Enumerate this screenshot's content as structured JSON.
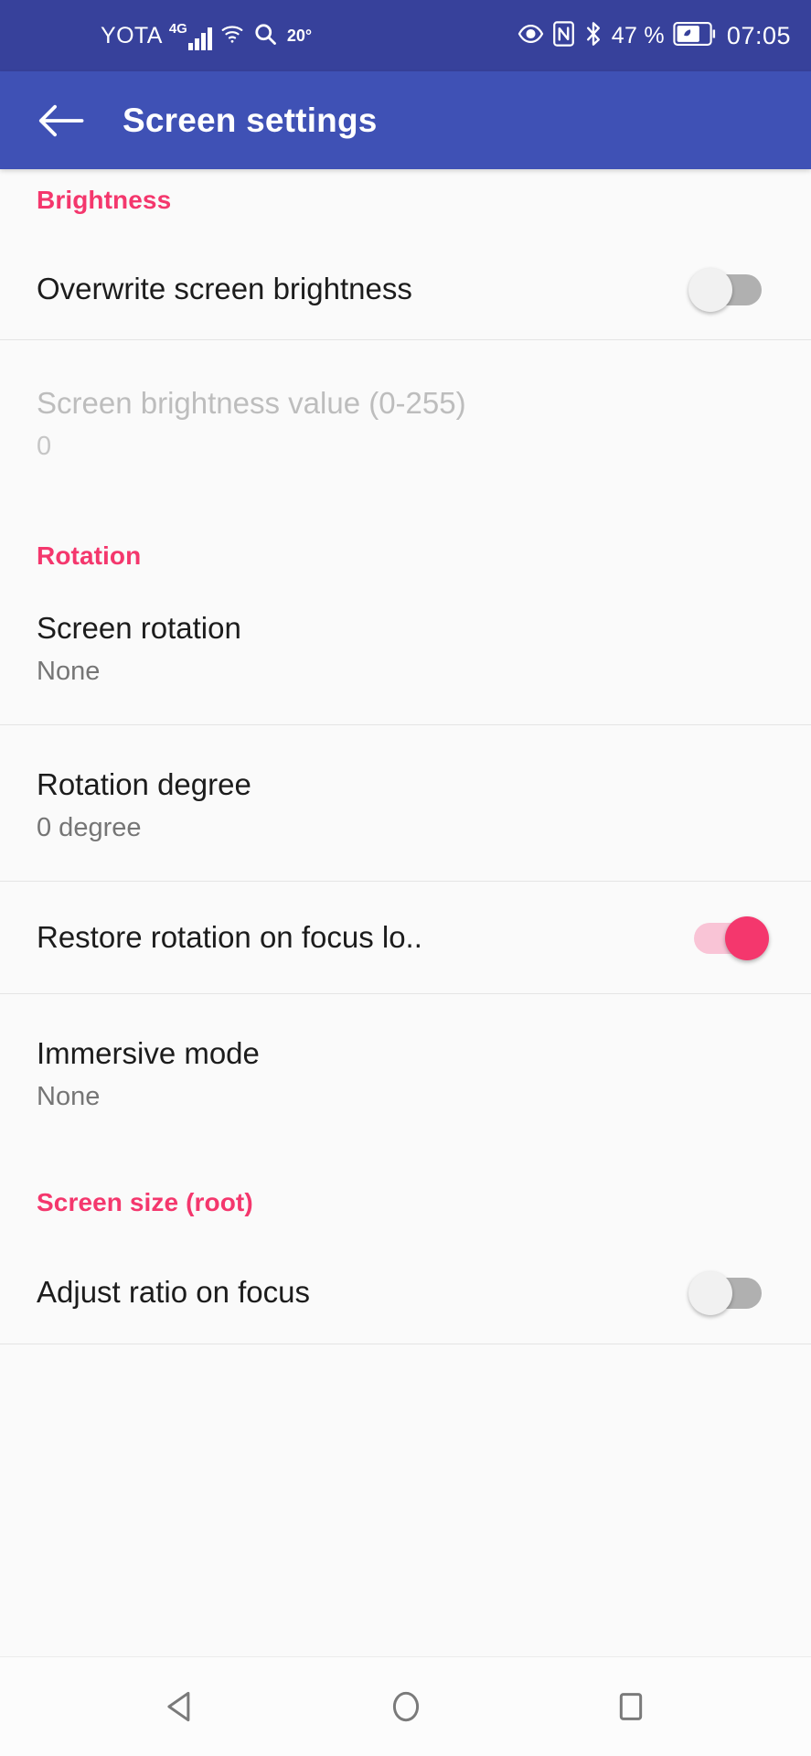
{
  "status_bar": {
    "carrier": "YOTA",
    "network_type": "4G",
    "temperature": "20°",
    "battery_percent": "47 %",
    "clock": "07:05",
    "icons": [
      "signal-bars-icon",
      "wifi-icon",
      "search-icon",
      "eye-comfort-icon",
      "nfc-icon",
      "bluetooth-icon",
      "battery-saver-icon"
    ],
    "colors": {
      "background": "#37419b",
      "foreground": "#ffffff"
    }
  },
  "app_bar": {
    "back_label": "back-arrow",
    "title": "Screen settings",
    "colors": {
      "background": "#3f51b5",
      "foreground": "#ffffff"
    }
  },
  "theme": {
    "accent": "#f4376d",
    "page_background": "#fafafa",
    "title_color": "#1c1c1c",
    "subtitle_color": "#757575",
    "disabled_color": "#bdbdbd",
    "divider": "#e4e4e4"
  },
  "sections": [
    {
      "header": "Brightness",
      "rows": [
        {
          "title": "Overwrite screen brightness",
          "subtitle": "",
          "control": "switch",
          "switch_on": false,
          "enabled": true
        },
        {
          "title": "Screen brightness value (0-255)",
          "subtitle": "0",
          "control": "none",
          "enabled": false
        }
      ]
    },
    {
      "header": "Rotation",
      "rows": [
        {
          "title": "Screen rotation",
          "subtitle": "None",
          "control": "none",
          "enabled": true
        },
        {
          "title": "Rotation degree",
          "subtitle": "0 degree",
          "control": "none",
          "enabled": true
        },
        {
          "title": "Restore rotation on focus lo..",
          "subtitle": "",
          "control": "switch",
          "switch_on": true,
          "enabled": true
        },
        {
          "title": "Immersive mode",
          "subtitle": "None",
          "control": "none",
          "enabled": true
        }
      ]
    },
    {
      "header": "Screen size (root)",
      "rows": [
        {
          "title": "Adjust ratio on focus",
          "subtitle": "",
          "control": "switch",
          "switch_on": false,
          "enabled": true
        }
      ]
    }
  ],
  "nav_bar": {
    "back": "back-triangle-icon",
    "home": "home-circle-icon",
    "recents": "recents-square-icon"
  }
}
